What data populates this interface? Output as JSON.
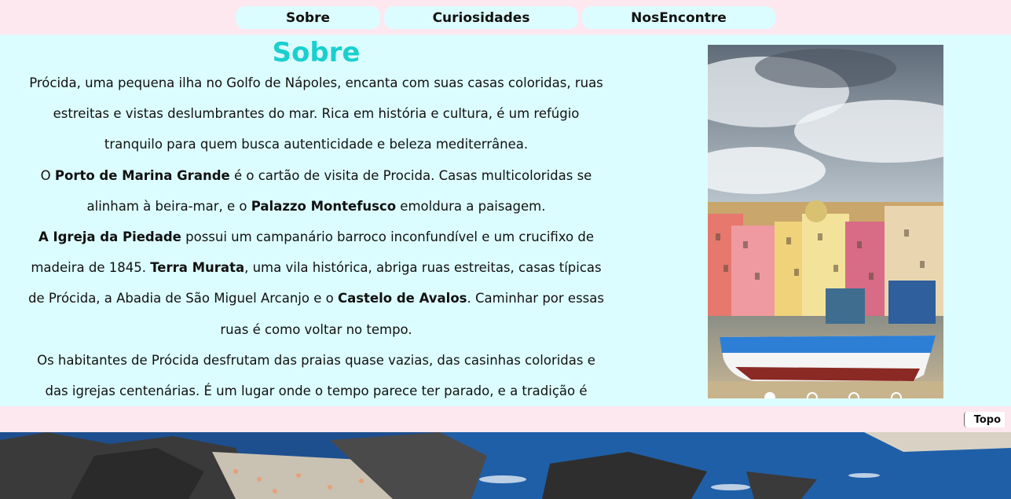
{
  "nav": {
    "items": [
      "Sobre",
      "Curiosidades",
      "NosEncontre"
    ]
  },
  "section": {
    "title": "Sobre",
    "p1": "Prócida, uma pequena ilha no Golfo de Nápoles, encanta com suas casas coloridas, ruas estreitas e vistas deslumbrantes do mar. Rica em história e cultura, é um refúgio tranquilo para quem busca autenticidade e beleza mediterrânea.",
    "p2_a": "O ",
    "p2_b": "Porto de Marina Grande",
    "p2_c": " é o cartão de visita de Procida. Casas multicoloridas se alinham à beira-mar, e o ",
    "p2_d": "Palazzo Montefusco",
    "p2_e": " emoldura a paisagem.",
    "p3_a": "A Igreja da Piedade",
    "p3_b": " possui um campanário barroco inconfundível e um crucifixo de madeira de 1845. ",
    "p3_c": "Terra Murata",
    "p3_d": ", uma vila histórica, abriga ruas estreitas, casas típicas de Prócida, a Abadia de São Miguel Arcanjo e o ",
    "p3_e": "Castelo de Avalos",
    "p3_f": ". Caminhar por essas ruas é como voltar no tempo.",
    "p4": "Os habitantes de Prócida desfrutam das praias quase vazias, das casinhas coloridas e das igrejas centenárias. É um lugar onde o tempo parece ter parado, e a tradição é valorizada."
  },
  "carousel": {
    "slides": 4,
    "active_index": 0
  },
  "footer": {
    "topo_label": "Topo"
  },
  "colors": {
    "nav_bg": "#fde8ef",
    "content_bg": "#dcfdff",
    "title": "#1ccfcf"
  }
}
